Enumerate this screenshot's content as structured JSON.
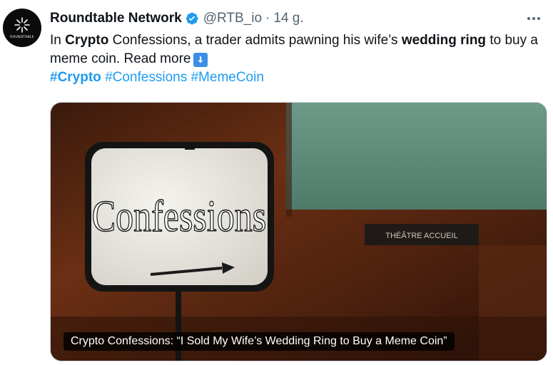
{
  "author": {
    "display_name": "Roundtable Network",
    "handle": "@RTB_io",
    "separator": "·",
    "time": "14 g.",
    "verified": true,
    "avatar_text": "ROUNDTABLE"
  },
  "tweet": {
    "text_before_bold1": "In ",
    "bold1": "Crypto",
    "text_mid": " Confessions, a trader admits pawning his wife’s ",
    "bold2": "wedding ring",
    "text_after": " to buy a meme coin. Read more",
    "emoji": "down-arrow-emoji",
    "hashtags": [
      "#Crypto",
      "#Confessions",
      "#MemeCoin"
    ]
  },
  "media": {
    "sign_text": "Confessions",
    "plaque_text": "THÉÂTRE ACCUEIL",
    "caption": "Crypto Confessions: “I Sold My Wife’s Wedding Ring to Buy a Meme Coin”"
  },
  "colors": {
    "accent": "#1d9bf0",
    "text": "#0f1419",
    "muted": "#536471"
  }
}
